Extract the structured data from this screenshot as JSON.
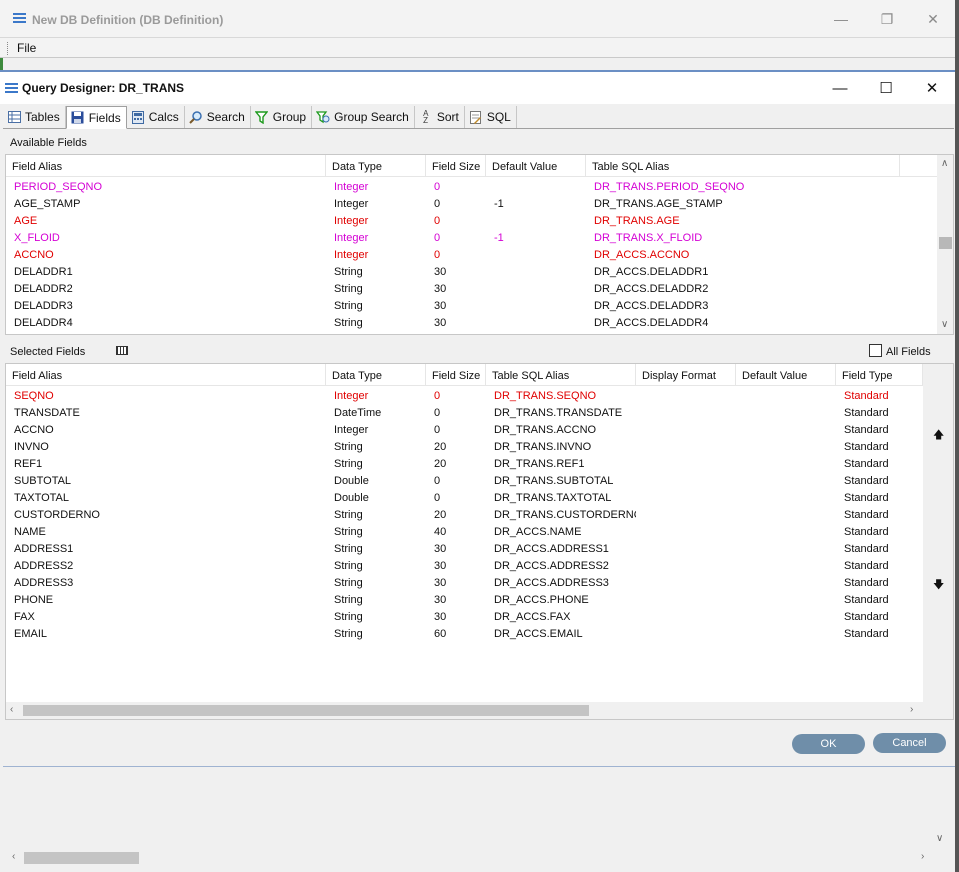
{
  "outer": {
    "title": "New DB Definition (DB Definition)",
    "menu_file": "File"
  },
  "dialog": {
    "title": "Query Designer: DR_TRANS"
  },
  "tabs": [
    {
      "label": "Tables",
      "icon": "table-icon"
    },
    {
      "label": "Fields",
      "icon": "save-disk-icon"
    },
    {
      "label": "Calcs",
      "icon": "calculator-icon"
    },
    {
      "label": "Search",
      "icon": "magnifier-icon"
    },
    {
      "label": "Group",
      "icon": "funnel-icon"
    },
    {
      "label": "Group Search",
      "icon": "funnel-search-icon"
    },
    {
      "label": "Sort",
      "icon": "sort-az-icon"
    },
    {
      "label": "SQL",
      "icon": "sql-icon"
    }
  ],
  "available": {
    "section_label": "Available Fields",
    "columns": [
      "Field Alias",
      "Data Type",
      "Field Size",
      "Default Value",
      "Table SQL Alias"
    ],
    "rows": [
      [
        "PERIOD_SEQNO",
        "Integer",
        "0",
        "",
        "DR_TRANS.PERIOD_SEQNO",
        "pink"
      ],
      [
        "AGE_STAMP",
        "Integer",
        "0",
        "-1",
        "DR_TRANS.AGE_STAMP",
        "blk"
      ],
      [
        "AGE",
        "Integer",
        "0",
        "",
        "DR_TRANS.AGE",
        "red"
      ],
      [
        "X_FLOID",
        "Integer",
        "0",
        "-1",
        "DR_TRANS.X_FLOID",
        "pink"
      ],
      [
        "ACCNO",
        "Integer",
        "0",
        "",
        "DR_ACCS.ACCNO",
        "red"
      ],
      [
        "DELADDR1",
        "String",
        "30",
        "",
        "DR_ACCS.DELADDR1",
        "blk"
      ],
      [
        "DELADDR2",
        "String",
        "30",
        "",
        "DR_ACCS.DELADDR2",
        "blk"
      ],
      [
        "DELADDR3",
        "String",
        "30",
        "",
        "DR_ACCS.DELADDR3",
        "blk"
      ],
      [
        "DELADDR4",
        "String",
        "30",
        "",
        "DR_ACCS.DELADDR4",
        "blk"
      ]
    ]
  },
  "selected": {
    "section_label": "Selected Fields",
    "all_fields_label": "All Fields",
    "columns": [
      "Field Alias",
      "Data Type",
      "Field Size",
      "Table SQL Alias",
      "Display Format",
      "Default Value",
      "Field Type"
    ],
    "rows": [
      [
        "SEQNO",
        "Integer",
        "0",
        "DR_TRANS.SEQNO",
        "",
        "",
        "Standard",
        "red"
      ],
      [
        "TRANSDATE",
        "DateTime",
        "0",
        "DR_TRANS.TRANSDATE",
        "",
        "",
        "Standard",
        "blk"
      ],
      [
        "ACCNO",
        "Integer",
        "0",
        "DR_TRANS.ACCNO",
        "",
        "",
        "Standard",
        "blk"
      ],
      [
        "INVNO",
        "String",
        "20",
        "DR_TRANS.INVNO",
        "",
        "",
        "Standard",
        "blk"
      ],
      [
        "REF1",
        "String",
        "20",
        "DR_TRANS.REF1",
        "",
        "",
        "Standard",
        "blk"
      ],
      [
        "SUBTOTAL",
        "Double",
        "0",
        "DR_TRANS.SUBTOTAL",
        "",
        "",
        "Standard",
        "blk"
      ],
      [
        "TAXTOTAL",
        "Double",
        "0",
        "DR_TRANS.TAXTOTAL",
        "",
        "",
        "Standard",
        "blk"
      ],
      [
        "CUSTORDERNO",
        "String",
        "20",
        "DR_TRANS.CUSTORDERNO",
        "",
        "",
        "Standard",
        "blk"
      ],
      [
        "NAME",
        "String",
        "40",
        "DR_ACCS.NAME",
        "",
        "",
        "Standard",
        "blk"
      ],
      [
        "ADDRESS1",
        "String",
        "30",
        "DR_ACCS.ADDRESS1",
        "",
        "",
        "Standard",
        "blk"
      ],
      [
        "ADDRESS2",
        "String",
        "30",
        "DR_ACCS.ADDRESS2",
        "",
        "",
        "Standard",
        "blk"
      ],
      [
        "ADDRESS3",
        "String",
        "30",
        "DR_ACCS.ADDRESS3",
        "",
        "",
        "Standard",
        "blk"
      ],
      [
        "PHONE",
        "String",
        "30",
        "DR_ACCS.PHONE",
        "",
        "",
        "Standard",
        "blk"
      ],
      [
        "FAX",
        "String",
        "30",
        "DR_ACCS.FAX",
        "",
        "",
        "Standard",
        "blk"
      ],
      [
        "EMAIL",
        "String",
        "60",
        "DR_ACCS.EMAIL",
        "",
        "",
        "Standard",
        "blk"
      ]
    ]
  },
  "buttons": {
    "ok": "OK",
    "cancel": "Cancel"
  },
  "colors": {
    "pink": "#d400d4",
    "red": "#e00000",
    "button": "#6f8ea9"
  }
}
